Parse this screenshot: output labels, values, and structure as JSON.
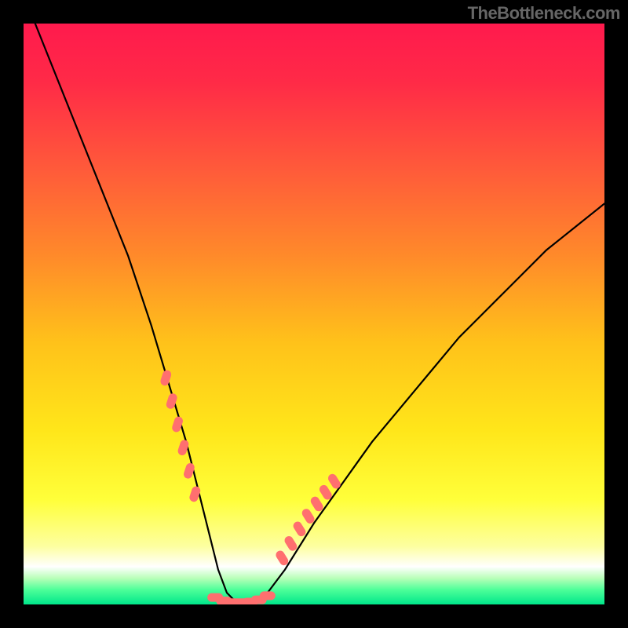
{
  "attribution": "TheBottleneck.com",
  "colors": {
    "frame": "#000000",
    "gradient_stops": [
      {
        "offset": 0.0,
        "color": "#ff1a4d"
      },
      {
        "offset": 0.1,
        "color": "#ff2a47"
      },
      {
        "offset": 0.25,
        "color": "#ff5a3a"
      },
      {
        "offset": 0.4,
        "color": "#ff8a2a"
      },
      {
        "offset": 0.55,
        "color": "#ffc21a"
      },
      {
        "offset": 0.7,
        "color": "#ffe61a"
      },
      {
        "offset": 0.82,
        "color": "#ffff3a"
      },
      {
        "offset": 0.9,
        "color": "#fdffa0"
      },
      {
        "offset": 0.935,
        "color": "#ffffff"
      },
      {
        "offset": 0.955,
        "color": "#b8ffb8"
      },
      {
        "offset": 0.975,
        "color": "#4cff99"
      },
      {
        "offset": 1.0,
        "color": "#00e68a"
      }
    ],
    "curve": "#000000",
    "marker": "#ff6f6f"
  },
  "chart_data": {
    "type": "line",
    "title": "",
    "xlabel": "",
    "ylabel": "",
    "xlim": [
      0,
      100
    ],
    "ylim": [
      0,
      100
    ],
    "grid": false,
    "note": "Axes have no visible tick labels in the source image; x/y values are in arbitrary chart-percentage units read from position on the plot area.",
    "series": [
      {
        "name": "bottleneck-curve",
        "x": [
          2,
          6,
          10,
          14,
          18,
          22,
          25,
          28,
          30,
          32,
          33.5,
          35,
          37,
          38.5,
          40,
          42,
          45,
          50,
          55,
          60,
          65,
          70,
          75,
          80,
          85,
          90,
          95,
          100
        ],
        "y": [
          100,
          90,
          80,
          70,
          60,
          48,
          38,
          28,
          20,
          12,
          6,
          2,
          0,
          0,
          0,
          2,
          6,
          14,
          21,
          28,
          34,
          40,
          46,
          51,
          56,
          61,
          65,
          69
        ]
      }
    ],
    "markers": [
      {
        "name": "marker-left-segment",
        "x": [
          24.5,
          25.5,
          26.5,
          27.5,
          28.5,
          29.5
        ],
        "y": [
          39,
          35,
          31,
          27,
          23,
          19
        ],
        "rotation_deg": -72
      },
      {
        "name": "marker-right-segment",
        "x": [
          44.5,
          46.0,
          47.5,
          49.0,
          50.5,
          52.0,
          53.5
        ],
        "y": [
          8,
          10.5,
          13,
          15.2,
          17.3,
          19.3,
          21.2
        ],
        "rotation_deg": 58
      },
      {
        "name": "marker-bottom-segment",
        "x": [
          33.0,
          34.5,
          36.0,
          37.5,
          39.0,
          40.5,
          42.0
        ],
        "y": [
          1.2,
          0.6,
          0.3,
          0.3,
          0.4,
          0.8,
          1.5
        ],
        "rotation_deg": 0
      }
    ]
  }
}
